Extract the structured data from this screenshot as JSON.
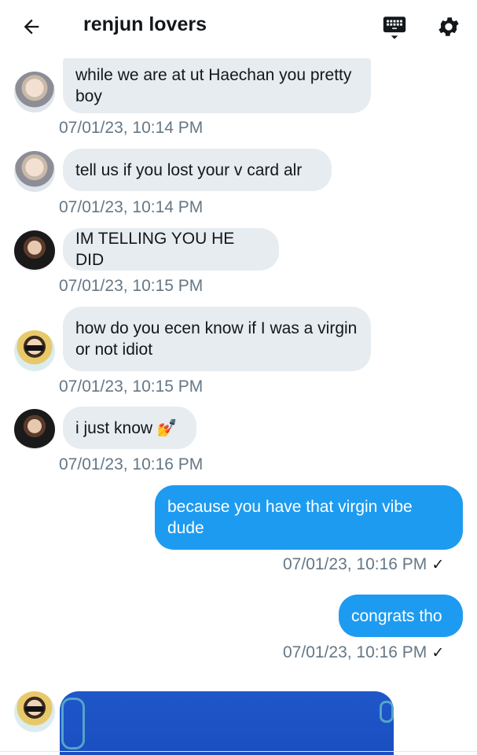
{
  "header": {
    "title": "renjun lovers",
    "back_icon": "arrow-left-icon",
    "keyboard_icon": "keyboard-icon",
    "settings_icon": "gear-icon"
  },
  "messages": [
    {
      "direction": "in",
      "avatar": "haechan",
      "text": "while we are at ut Haechan you pretty boy",
      "time": "07/01/23, 10:14 PM"
    },
    {
      "direction": "in",
      "avatar": "haechan",
      "text": "tell us if you lost your v card alr",
      "time": "07/01/23, 10:14 PM"
    },
    {
      "direction": "in",
      "avatar": "dark",
      "text": "IM TELLING YOU HE DID",
      "time": "07/01/23, 10:15 PM"
    },
    {
      "direction": "in",
      "avatar": "glasses",
      "text": "how do you ecen know if I was a virgin or not idiot",
      "time": "07/01/23, 10:15 PM"
    },
    {
      "direction": "in",
      "avatar": "dark",
      "text": "i just know 💅",
      "time": "07/01/23, 10:16 PM"
    },
    {
      "direction": "out",
      "text": "because you have that virgin vibe dude",
      "time": "07/01/23, 10:16 PM",
      "status": "✓"
    },
    {
      "direction": "out",
      "text": "congrats tho",
      "time": "07/01/23, 10:16 PM",
      "status": "✓"
    }
  ],
  "colors": {
    "accent": "#1d9bf0",
    "incoming": "#e6ecf0",
    "timestamp": "#657786"
  }
}
